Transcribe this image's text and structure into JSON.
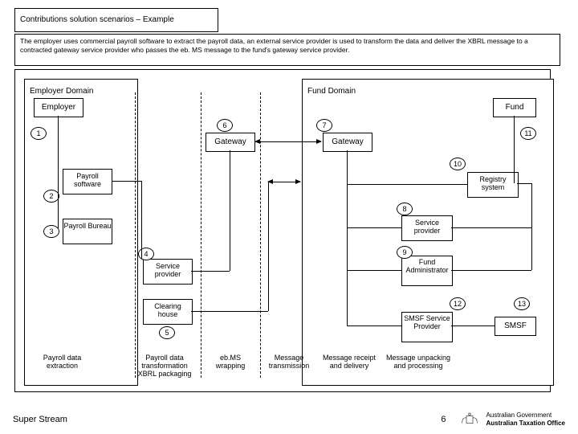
{
  "title": "Contributions solution scenarios – Example",
  "description": "The employer uses commercial payroll software to extract the payroll data, an external service provider is used to transform the data and deliver the XBRL message to a contracted gateway service provider who passes the eb. MS message to the fund's gateway service provider.",
  "domains": {
    "employer": "Employer Domain",
    "fund": "Fund Domain"
  },
  "nodes": {
    "employer": "Employer",
    "payroll_software": "Payroll software",
    "payroll_bureau": "Payroll Bureau",
    "service_provider_left": "Service provider",
    "clearing_house": "Clearing house",
    "gateway_left": "Gateway",
    "gateway_right": "Gateway",
    "fund": "Fund",
    "registry_system": "Registry system",
    "service_provider_right": "Service provider",
    "fund_administrator": "Fund Administrator",
    "smsf_service_provider": "SMSF Service Provider",
    "smsf": "SMSF"
  },
  "steps": {
    "s1": "1",
    "s2": "2",
    "s3": "3",
    "s4": "4",
    "s5": "5",
    "s6": "6",
    "s7": "7",
    "s8": "8",
    "s9": "9",
    "s10": "10",
    "s11": "11",
    "s12": "12",
    "s13": "13"
  },
  "captions": {
    "c1": "Payroll data extraction",
    "c2": "Payroll data transformation XBRL packaging",
    "c3": "eb.MS wrapping",
    "c4": "Message transmission",
    "c5": "Message receipt and delivery",
    "c6": "Message unpacking and processing"
  },
  "footer": {
    "left": "Super Stream",
    "right": "6",
    "gov1": "Australian Government",
    "gov2": "Australian Taxation Office"
  }
}
